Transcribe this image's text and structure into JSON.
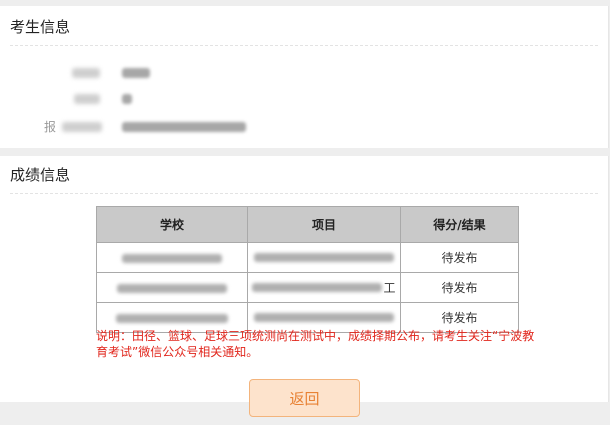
{
  "candidate_info": {
    "title": "考生信息",
    "partial_label": "报"
  },
  "score_info": {
    "title": "成绩信息",
    "table": {
      "headers": [
        "学校",
        "项目",
        "得分/结果"
      ],
      "rows": [
        {
          "project_suffix": "",
          "result": "待发布"
        },
        {
          "project_suffix": "工",
          "result": "待发布"
        },
        {
          "project_suffix": "",
          "result": "待发布"
        }
      ]
    },
    "note": "说明：田径、篮球、足球三项统测尚在测试中，成绩择期公布，请考生关注“宁波教育考试”微信公众号相关通知。"
  },
  "actions": {
    "back_label": "返回"
  }
}
